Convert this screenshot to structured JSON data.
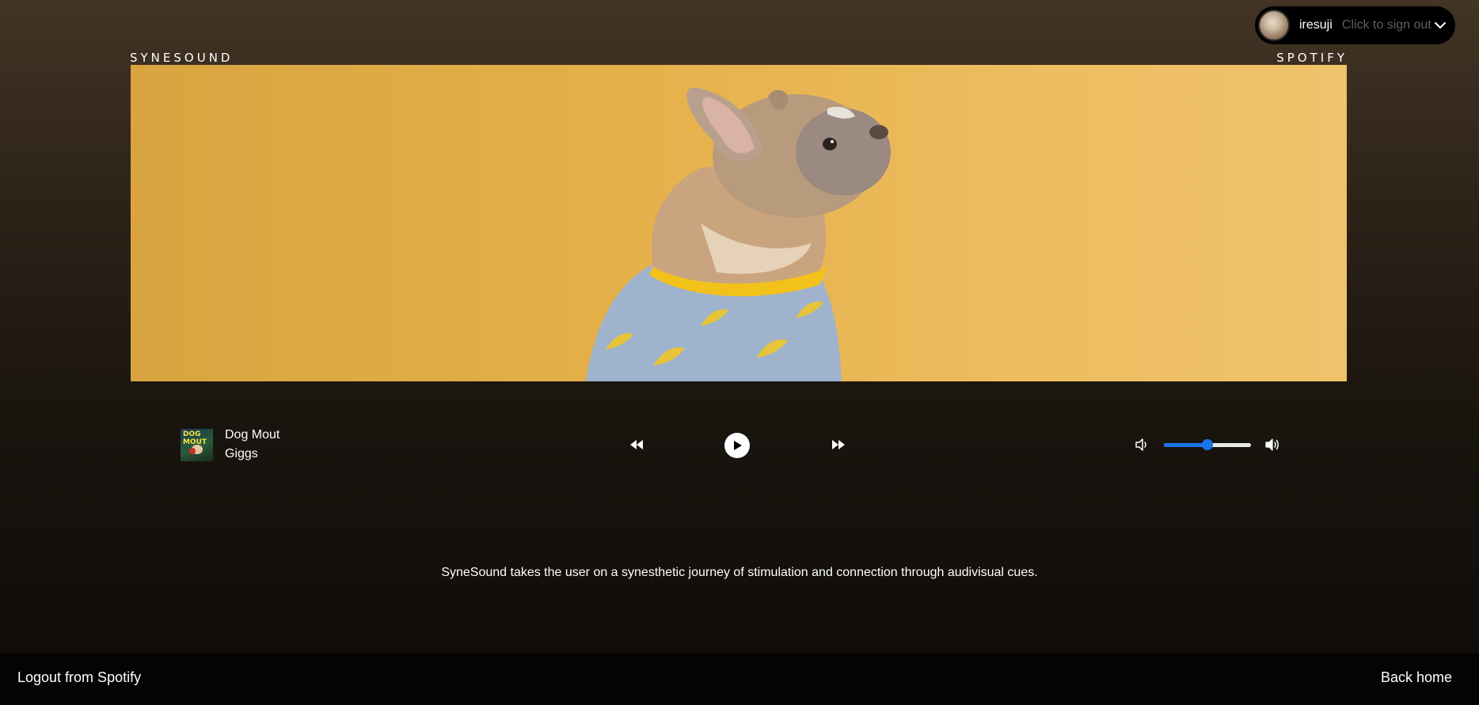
{
  "header": {
    "brand_left": "SYNESOUND",
    "brand_right": "SPOTIFY"
  },
  "user": {
    "name": "iresuji",
    "signout_hint": "Click to sign out",
    "avatar_icon": "avatar-image",
    "menu_icon": "chevron-down-icon"
  },
  "hero": {
    "image": "french-bulldog-in-banana-shirt-on-yellow-background"
  },
  "player": {
    "track_title": "Dog Mout",
    "track_artist": "Giggs",
    "album_art_text": "DOG MOUT",
    "controls": {
      "previous_icon": "rewind-icon",
      "play_icon": "play-icon",
      "next_icon": "fast-forward-icon"
    },
    "volume": {
      "value": 0.5,
      "low_icon": "volume-low-icon",
      "high_icon": "volume-high-icon"
    }
  },
  "description": "SyneSound takes the user on a synesthetic journey of stimulation and connection through audivisual cues.",
  "footer": {
    "logout_label": "Logout from Spotify",
    "home_label": "Back home"
  },
  "colors": {
    "accent": "#1a73e8",
    "hero_yellow": "#e4b04a",
    "background_top": "#433424",
    "background_bottom": "#0e0b08"
  }
}
